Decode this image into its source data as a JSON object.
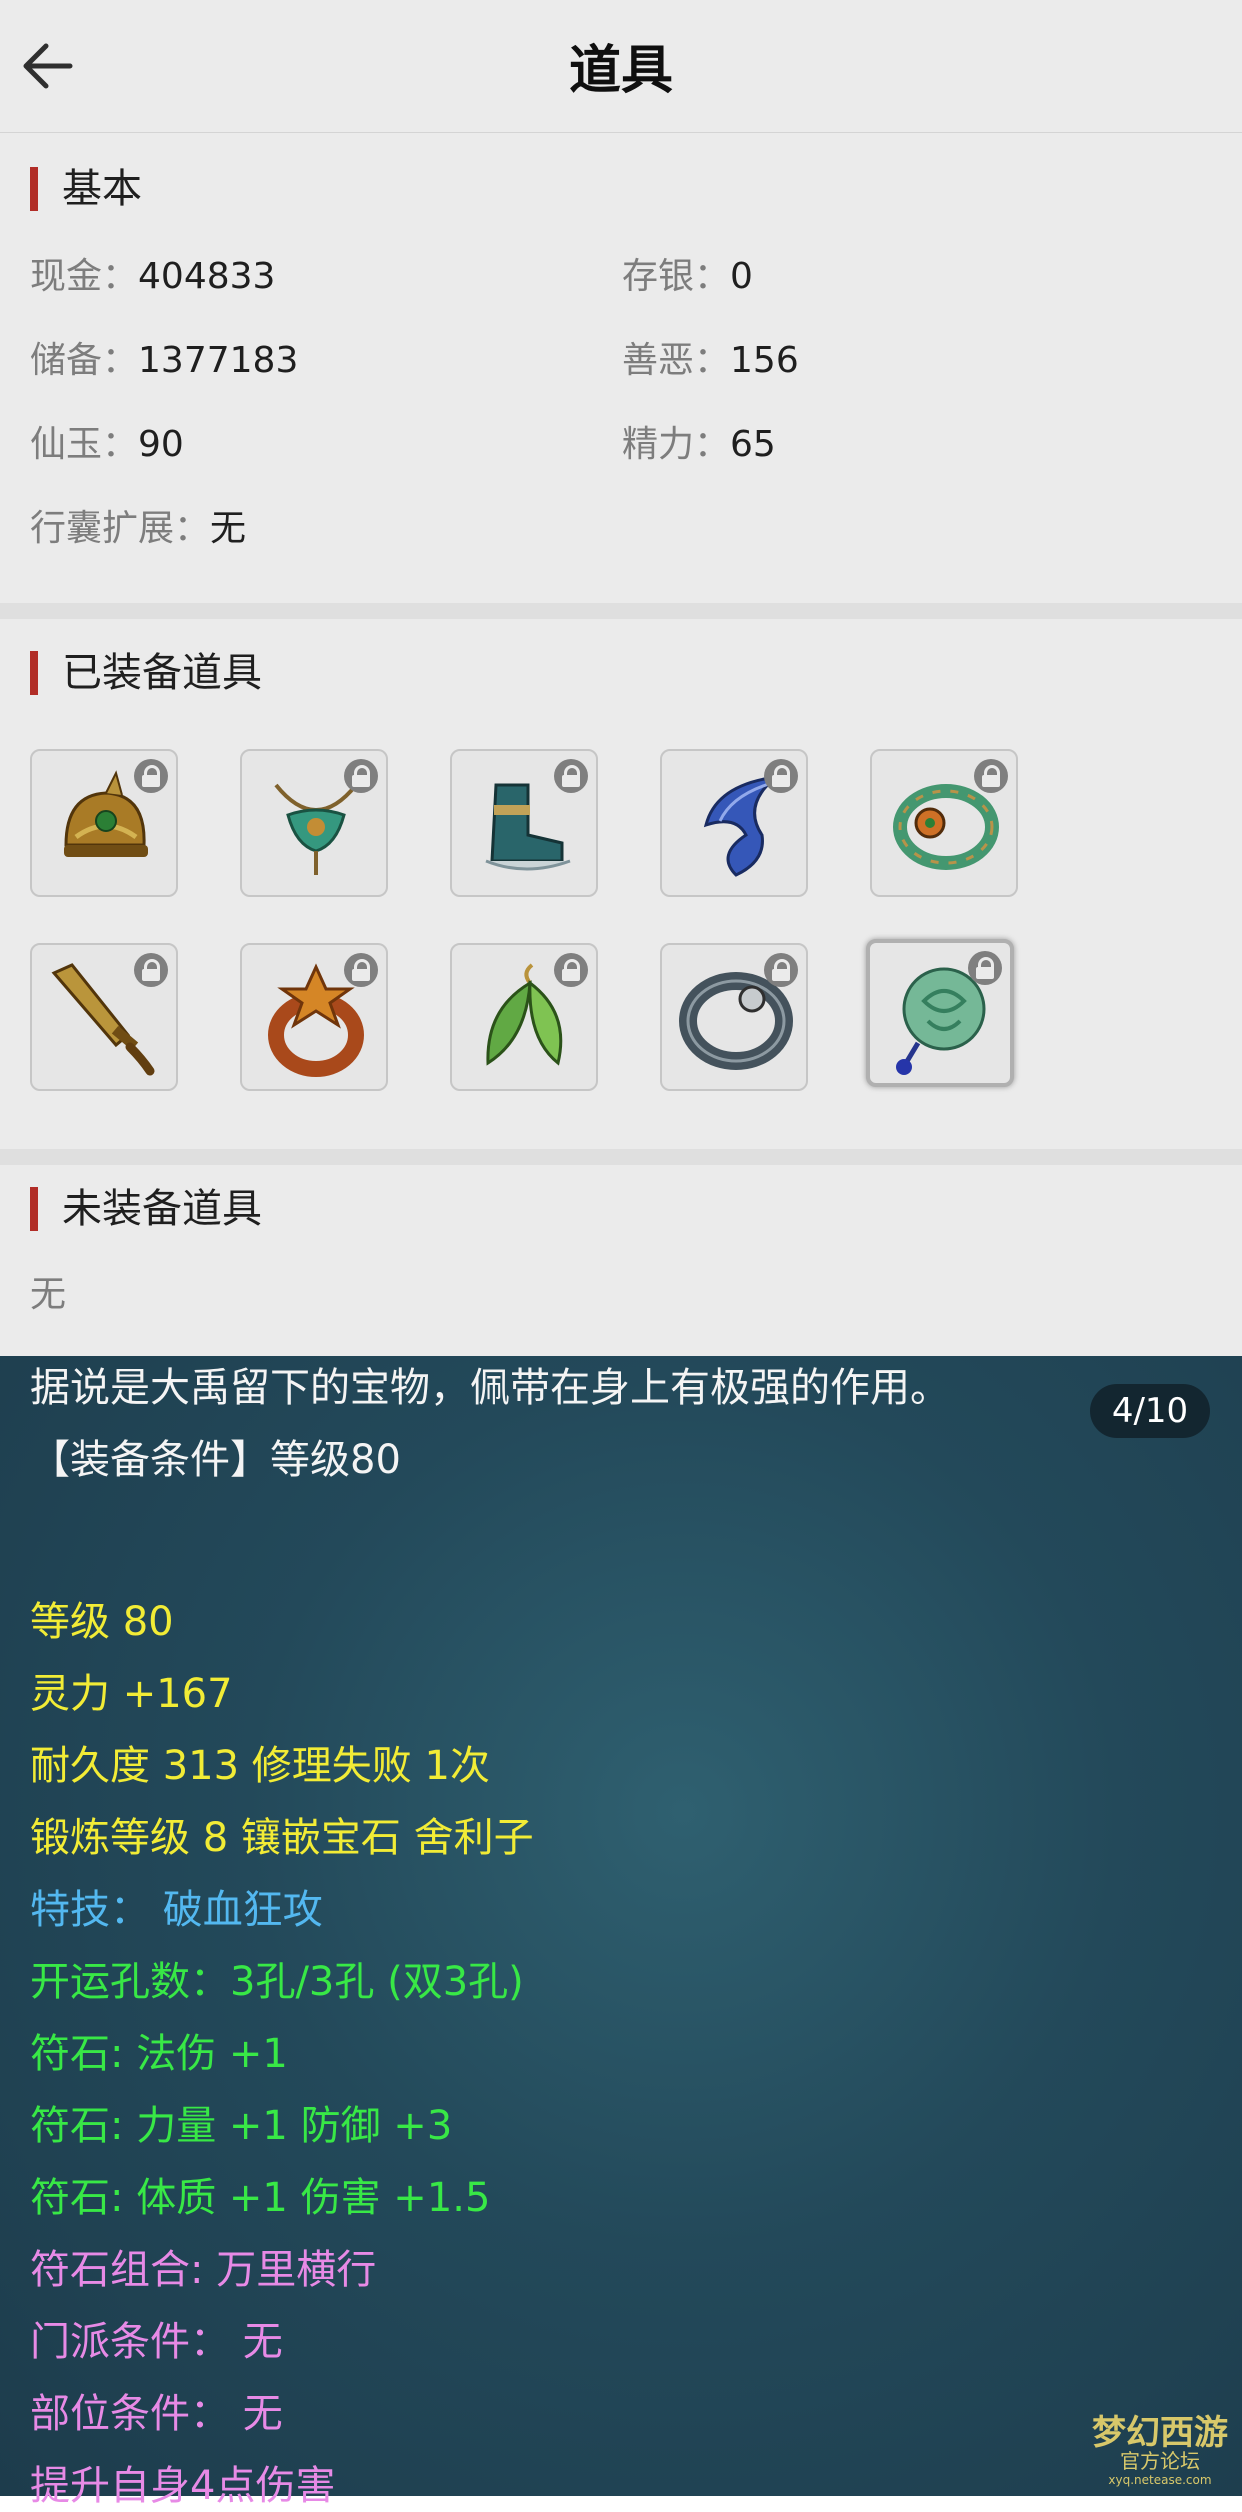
{
  "header": {
    "title": "道具"
  },
  "basic": {
    "section_title": "基本",
    "cash_label": "现金：",
    "cash_value": "404833",
    "deposit_label": "存银：",
    "deposit_value": "0",
    "reserve_label": "储备：",
    "reserve_value": "1377183",
    "karma_label": "善恶：",
    "karma_value": "156",
    "jade_label": "仙玉：",
    "jade_value": "90",
    "energy_label": "精力：",
    "energy_value": "65",
    "bag_label": "行囊扩展：",
    "bag_value": "无"
  },
  "equipped": {
    "section_title": "已装备道具",
    "items": [
      {
        "icon": "helmet-icon"
      },
      {
        "icon": "necklace-icon"
      },
      {
        "icon": "boots-icon"
      },
      {
        "icon": "ribbon-icon"
      },
      {
        "icon": "bracelet-icon"
      },
      {
        "icon": "sword-icon"
      },
      {
        "icon": "ring-icon"
      },
      {
        "icon": "leaf-earring-icon"
      },
      {
        "icon": "iron-ring-icon"
      },
      {
        "icon": "jade-pendant-icon"
      }
    ],
    "selected_index": 9
  },
  "unequipped": {
    "section_title": "未装备道具",
    "value": "无"
  },
  "tooltip": {
    "pager": "4/10",
    "desc": "据说是大禹留下的宝物，佩带在身上有极强的作用。",
    "requirement": "【装备条件】等级80",
    "level": "等级 80",
    "spirit": "灵力 +167",
    "durability": "耐久度 313 修理失败 1次",
    "forge": "锻炼等级 8 镶嵌宝石 舍利子",
    "skill": "特技：  破血狂攻",
    "holes": "开运孔数：3孔/3孔 (双3孔)",
    "rune1": "符石: 法伤 +1",
    "rune2": "符石: 力量 +1 防御 +3",
    "rune3": "符石: 体质 +1 伤害 +1.5",
    "rune_combo": "符石组合: 万里横行",
    "sect_req": "门派条件：  无",
    "part_req": "部位条件：  无",
    "bonus": "提升自身4点伤害"
  },
  "watermark": {
    "line1": "梦幻西游",
    "line2": "官方论坛",
    "line3": "xyq.netease.com"
  },
  "colors": {
    "accent_red": "#c0312b",
    "panel_bg": "#23495a",
    "yellow_text": "#f2ec36",
    "cyan_text": "#53b8f0",
    "green_text": "#38e846",
    "pink_text": "#e78ae6"
  }
}
